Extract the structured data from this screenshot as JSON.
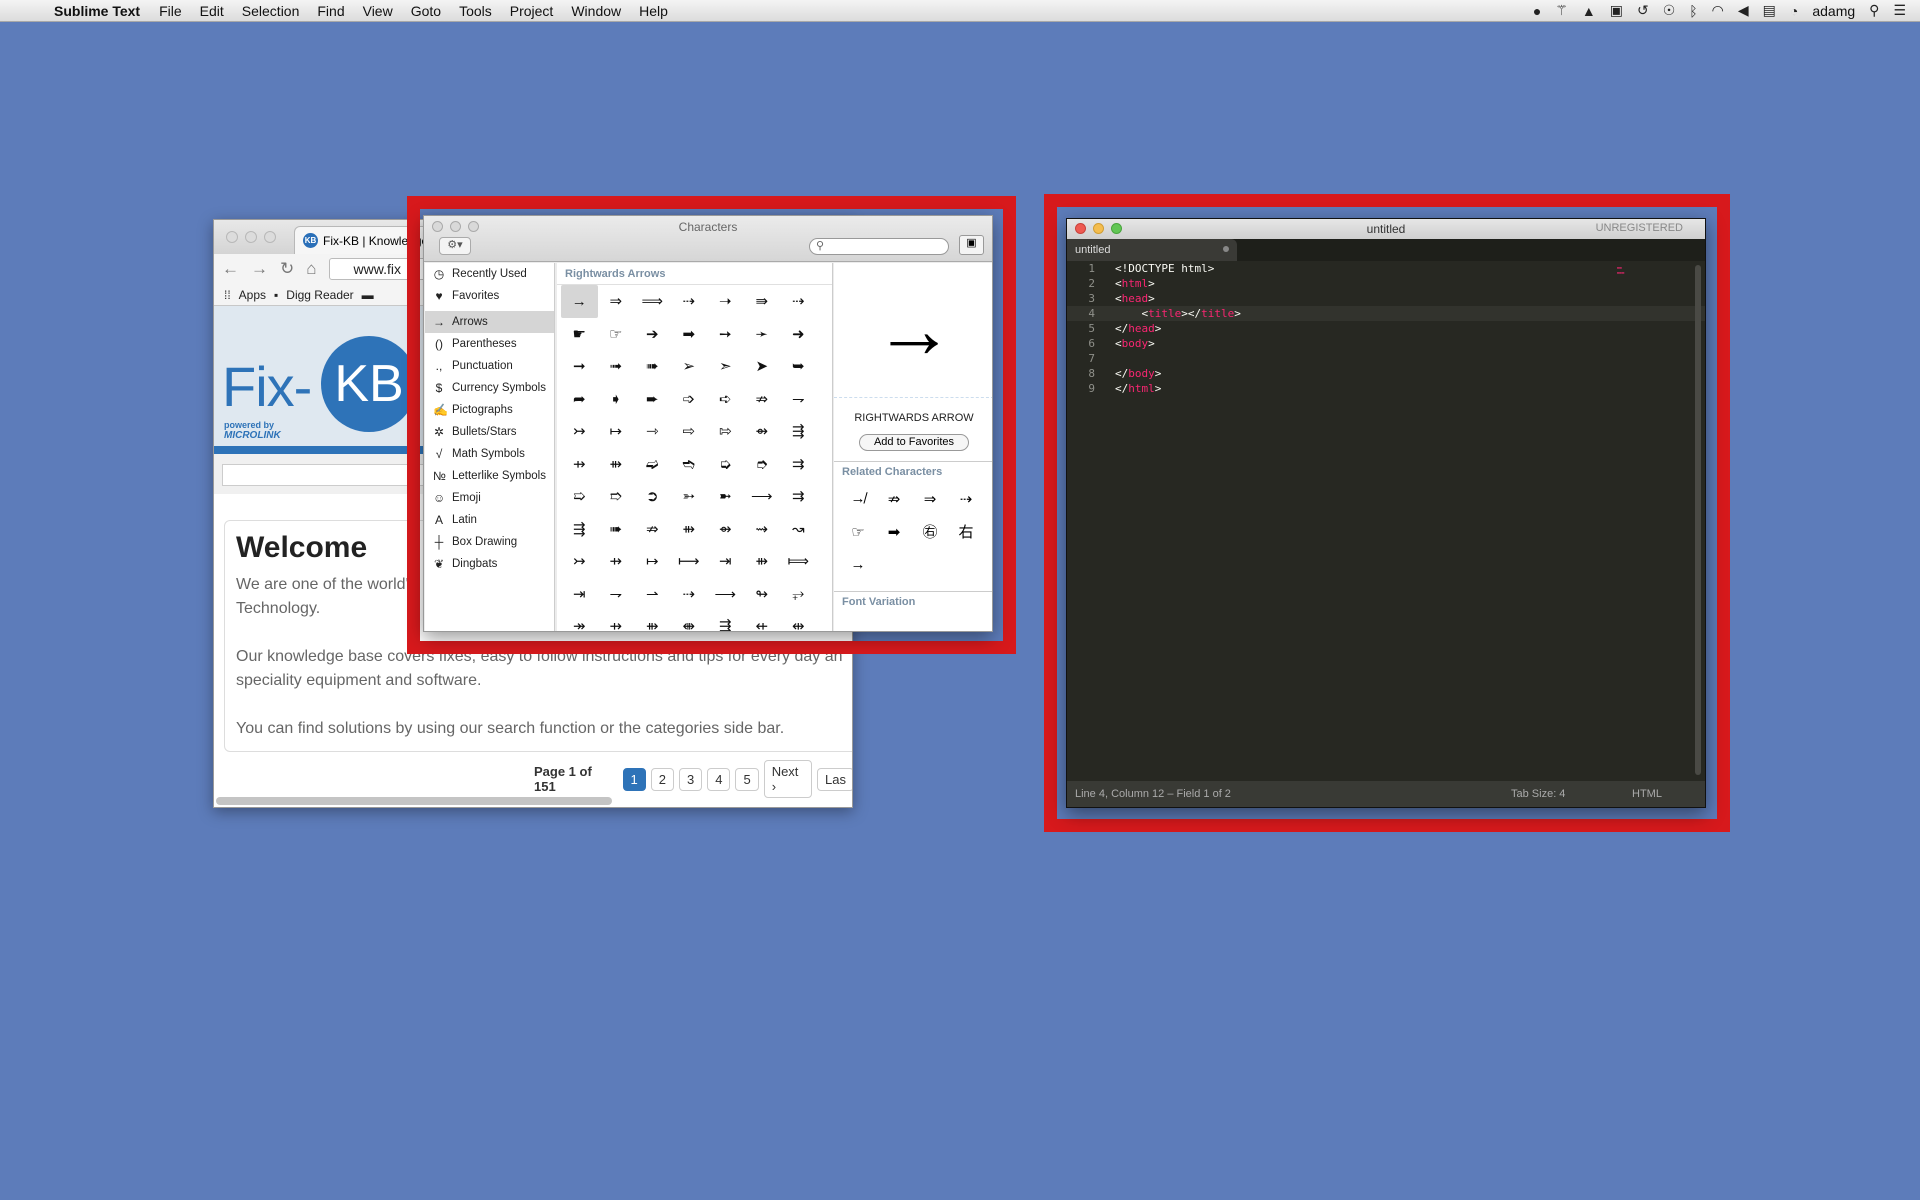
{
  "menubar": {
    "app_name": "Sublime Text",
    "items": [
      "File",
      "Edit",
      "Selection",
      "Find",
      "View",
      "Goto",
      "Tools",
      "Project",
      "Window",
      "Help"
    ],
    "user": "adamg"
  },
  "browser": {
    "tab_title": "Fix-KB | Knowledge",
    "url": "www.fix",
    "bookmarks": [
      "Apps",
      "Digg Reader"
    ],
    "logo_fix": "Fix-",
    "logo_kb": "KB",
    "powered_by": "powered by",
    "microlink": "MICROLINK",
    "welcome": "Welcome",
    "paragraphs": [
      "We are one of the world's",
      "Technology.",
      "Our knowledge base covers fixes, easy to follow instructions and tips for every day an",
      "speciality equipment and software.",
      "You can find solutions by using our search function or the categories side bar."
    ],
    "pager_label": "Page 1 of 151",
    "pages": [
      "1",
      "2",
      "3",
      "4",
      "5"
    ],
    "next": "Next ›",
    "last": "Las"
  },
  "characters": {
    "title": "Characters",
    "sidebar": [
      {
        "icon": "◷",
        "label": "Recently Used"
      },
      {
        "icon": "♥",
        "label": "Favorites"
      },
      {
        "icon": "→",
        "label": "Arrows",
        "selected": true
      },
      {
        "icon": "()",
        "label": "Parentheses"
      },
      {
        "icon": ".,",
        "label": "Punctuation"
      },
      {
        "icon": "$",
        "label": "Currency Symbols"
      },
      {
        "icon": "✍",
        "label": "Pictographs"
      },
      {
        "icon": "✲",
        "label": "Bullets/Stars"
      },
      {
        "icon": "√",
        "label": "Math Symbols"
      },
      {
        "icon": "№",
        "label": "Letterlike Symbols"
      },
      {
        "icon": "☺",
        "label": "Emoji"
      },
      {
        "icon": "A",
        "label": "Latin"
      },
      {
        "icon": "┼",
        "label": "Box Drawing"
      },
      {
        "icon": "❦",
        "label": "Dingbats"
      }
    ],
    "grid_heading": "Rightwards Arrows",
    "glyphs": [
      "→",
      "⇒",
      "⟹",
      "⇢",
      "➝",
      "⇛",
      "⇢",
      "☛",
      "☞",
      "➔",
      "➡",
      "➙",
      "➛",
      "➜",
      "➞",
      "➟",
      "➠",
      "➢",
      "➣",
      "➤",
      "➥",
      "➦",
      "➧",
      "➨",
      "➩",
      "➪",
      "⇏",
      "⇁",
      "↣",
      "↦",
      "⇾",
      "⇨",
      "⇰",
      "⇴",
      "⇶",
      "⇸",
      "⇻",
      "➫",
      "➬",
      "➭",
      "➮",
      "⇉",
      "➯",
      "➱",
      "➲",
      "➳",
      "➼",
      "⟶",
      "⇉",
      "⇶",
      "➠",
      "⇏",
      "⇻",
      "⇴",
      "⇝",
      "↝",
      "↣",
      "⇸",
      "↦",
      "⟼",
      "⇥",
      "⇻",
      "⟾",
      "⇥",
      "⇁",
      "⇀",
      "⇢",
      "⟶",
      "↬",
      "⥅",
      "↠",
      "⇸",
      "⇻",
      "⇼",
      "⇶",
      "⇷",
      "⇹"
    ],
    "selected_glyph": "→",
    "char_name": "RIGHTWARDS ARROW",
    "add_favorites": "Add to Favorites",
    "related_heading": "Related Characters",
    "related": [
      "↛",
      "⇏",
      "⇒",
      "⇢",
      "☞",
      "➡",
      "㊨",
      "右",
      "→"
    ],
    "font_variation_heading": "Font Variation"
  },
  "sublime": {
    "title": "untitled",
    "unregistered": "UNREGISTERED",
    "tab": "untitled",
    "lines": [
      {
        "n": "1",
        "parts": [
          [
            "t",
            "<!DOCTYPE html>"
          ]
        ]
      },
      {
        "n": "2",
        "parts": [
          [
            "t",
            "<"
          ],
          [
            "k",
            "html"
          ],
          [
            "t",
            ">"
          ]
        ]
      },
      {
        "n": "3",
        "parts": [
          [
            "t",
            "<"
          ],
          [
            "k",
            "head"
          ],
          [
            "t",
            ">"
          ]
        ]
      },
      {
        "n": "4",
        "parts": [
          [
            "t",
            "    <"
          ],
          [
            "k",
            "title"
          ],
          [
            "t",
            "></"
          ],
          [
            "k",
            "title"
          ],
          [
            "t",
            ">"
          ]
        ],
        "current": true
      },
      {
        "n": "5",
        "parts": [
          [
            "t",
            "</"
          ],
          [
            "k",
            "head"
          ],
          [
            "t",
            ">"
          ]
        ]
      },
      {
        "n": "6",
        "parts": [
          [
            "t",
            "<"
          ],
          [
            "k",
            "body"
          ],
          [
            "t",
            ">"
          ]
        ]
      },
      {
        "n": "7",
        "parts": []
      },
      {
        "n": "8",
        "parts": [
          [
            "t",
            "</"
          ],
          [
            "k",
            "body"
          ],
          [
            "t",
            ">"
          ]
        ]
      },
      {
        "n": "9",
        "parts": [
          [
            "t",
            "</"
          ],
          [
            "k",
            "html"
          ],
          [
            "t",
            ">"
          ]
        ]
      }
    ],
    "status_left": "Line 4, Column 12 – Field 1 of 2",
    "tab_size": "Tab Size: 4",
    "syntax": "HTML"
  },
  "colors": {
    "desktop": "#5d7cba",
    "highlight_frame": "#d7191c",
    "brand_blue": "#2e73b8",
    "tag_pink": "#f92672"
  }
}
